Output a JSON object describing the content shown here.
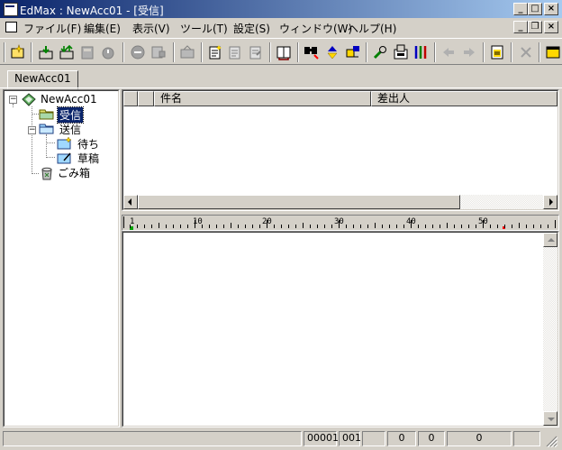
{
  "window": {
    "title": "EdMax : NewAcc01 - [受信]",
    "caption_buttons": [
      "_",
      "□",
      "×"
    ],
    "mdi_buttons": [
      "_",
      "❐",
      "×"
    ]
  },
  "menu": {
    "items": [
      "ファイル(F)",
      "編集(E)",
      "表示(V)",
      "ツール(T)",
      "設定(S)",
      "ウィンドウ(W)",
      "ヘルプ(H)"
    ]
  },
  "toolbar": {
    "icons": [
      "new-mail-icon",
      "receive-icon",
      "send-receive-icon",
      "send-icon",
      "check-icon",
      "stop-icon",
      "print-icon",
      "print-preview-icon",
      "compose-icon",
      "reply-icon",
      "forward-icon",
      "address-book-icon",
      "find-icon",
      "up-down-icon",
      "move-icon",
      "tools-icon",
      "account-icon",
      "settings-icon",
      "back-icon",
      "forward-arrow-icon",
      "note-icon",
      "delete-icon",
      "window-icon"
    ]
  },
  "tabs": [
    {
      "label": "NewAcc01"
    }
  ],
  "tree": {
    "account": "NewAcc01",
    "folders": [
      {
        "label": "受信",
        "selected": true
      },
      {
        "label": "送信"
      },
      {
        "label": "待ち"
      },
      {
        "label": "草稿"
      },
      {
        "label": "ごみ箱"
      }
    ]
  },
  "message_list": {
    "columns": [
      "",
      "件名",
      "差出人"
    ]
  },
  "ruler": {
    "numbers": [
      "1",
      "10",
      "20",
      "30",
      "40",
      "50"
    ]
  },
  "statusbar": {
    "fields": [
      "00001",
      "001",
      "",
      "0",
      "0",
      "0",
      ""
    ]
  },
  "colors": {
    "title_start": "#0a246a",
    "title_end": "#a6caf0",
    "chrome": "#d4d0c8",
    "selection": "#0a246a"
  }
}
